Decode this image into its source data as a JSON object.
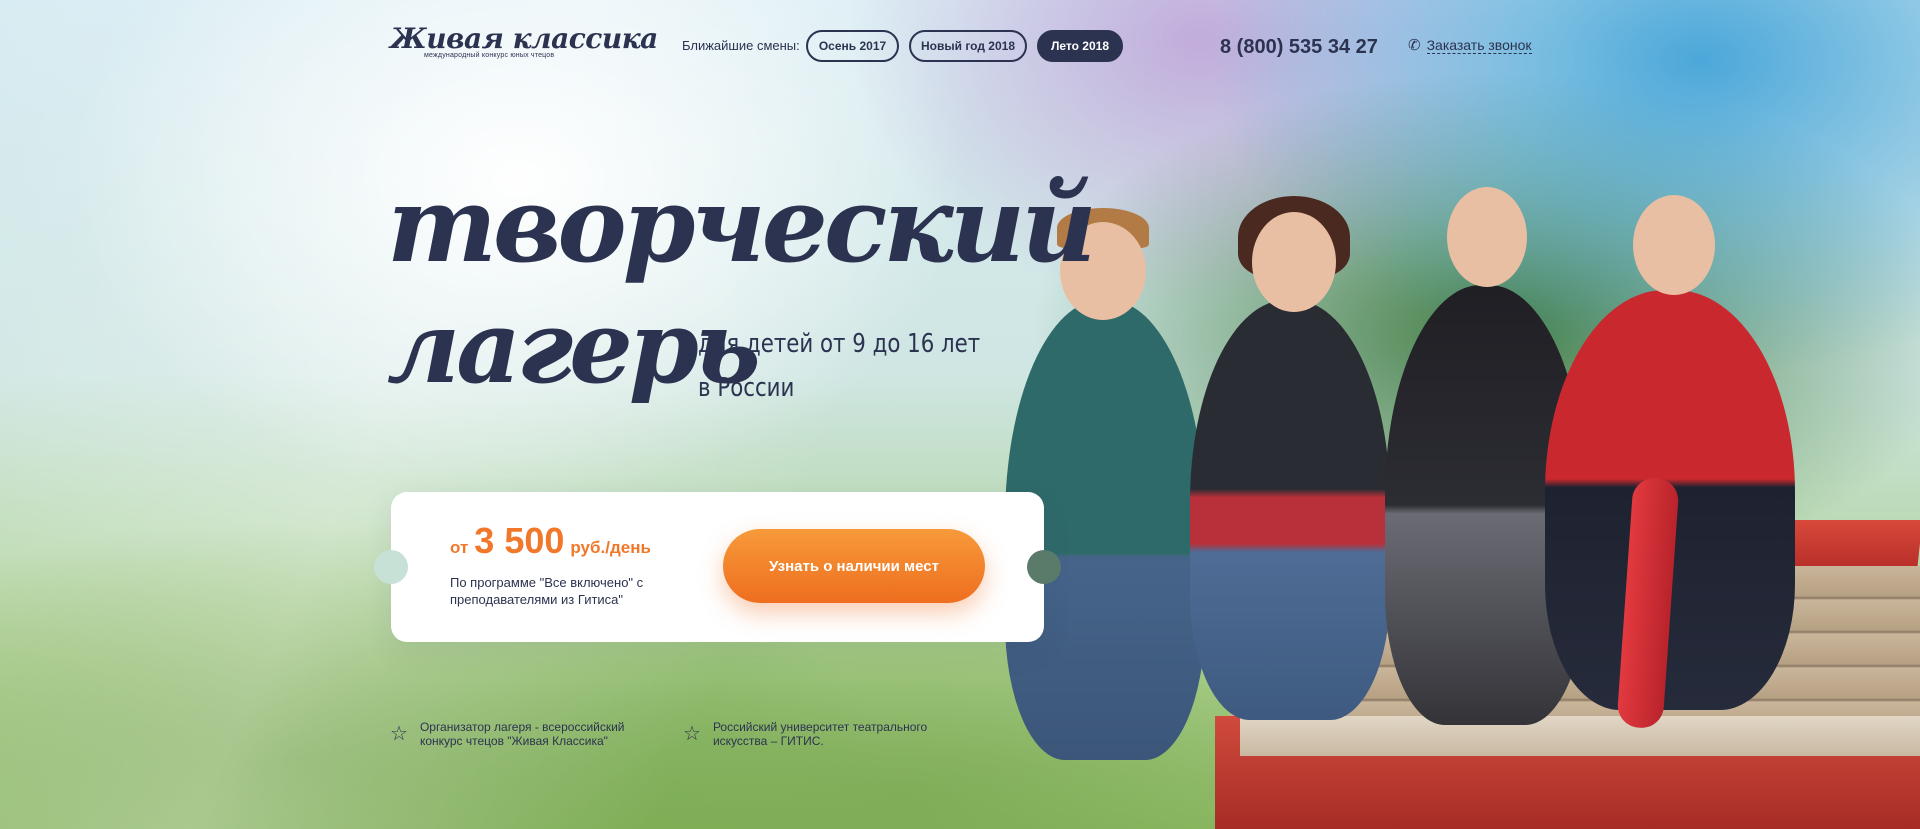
{
  "header": {
    "logo_title": "Живая классика",
    "logo_subtitle": "международный конкурс юных чтецов",
    "sessions_label": "Ближайшие смены:",
    "sessions": [
      {
        "label": "Осень 2017"
      },
      {
        "label": "Новый год 2018"
      },
      {
        "label": "Лето 2018"
      }
    ],
    "phone": "8 (800) 535 34 27",
    "callback_label": "Заказать звонок",
    "callback_icon": "phone-icon"
  },
  "hero": {
    "headline_line1": "творческий",
    "headline_line2": "лагерь",
    "sub_line1": "для детей от 9 до 16 лет",
    "sub_line2": "в России"
  },
  "offer": {
    "price_from": "от",
    "price_value": "3 500",
    "price_unit": "руб./день",
    "program_text": "По программе  \"Все включено\" с преподавателями из Гитиса\"",
    "cta_label": "Узнать о наличии мест"
  },
  "notes": [
    {
      "icon": "star-icon",
      "text": "Организатор лагеря - всероссийский конкурс чтецов \"Живая Классика\""
    },
    {
      "icon": "star-icon",
      "text": "Российский университет театрального искусства – ГИТИС."
    }
  ],
  "colors": {
    "primary": "#2c3350",
    "accent": "#f1782a",
    "button_gradient_top": "#f79a3a",
    "button_gradient_bottom": "#ee6e1f"
  }
}
